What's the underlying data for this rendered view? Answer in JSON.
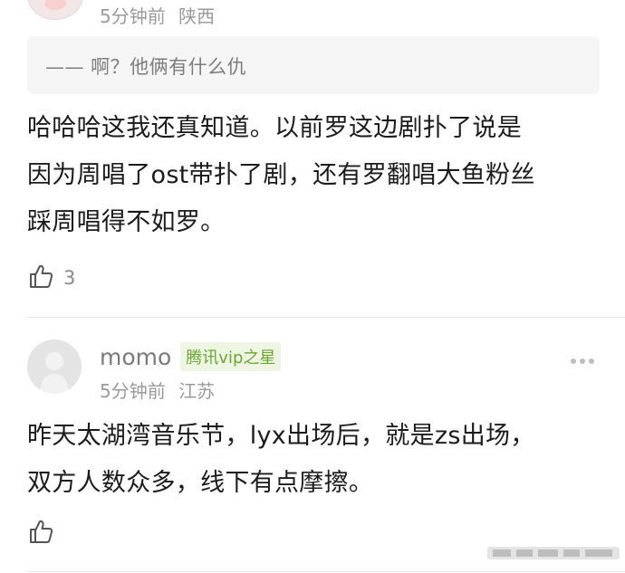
{
  "comment1": {
    "time": "5分钟前",
    "location": "陕西",
    "quote": "—— 啊？他俩有什么仇",
    "text_lines": [
      "哈哈哈这我还真知道。以前罗这边剧扑了说是",
      "因为周唱了ost带扑了剧，还有罗翻唱大鱼粉丝",
      "踩周唱得不如罗。"
    ],
    "likes": "3"
  },
  "comment2": {
    "username": "momo",
    "badge": "腾讯vip之星",
    "time": "5分钟前",
    "location": "江苏",
    "text_lines": [
      "昨天太湖湾音乐节，lyx出场后，就是zs出场，",
      "双方人数众多，线下有点摩擦。"
    ]
  },
  "icons": {
    "like": "thumbs-up-icon",
    "more": "more-dots-icon"
  },
  "colors": {
    "meta_text": "#9a9a9a",
    "vip_badge_text": "#6aa632",
    "vip_badge_bg": "#eef6e3",
    "quote_bg": "#f5f5f5"
  }
}
